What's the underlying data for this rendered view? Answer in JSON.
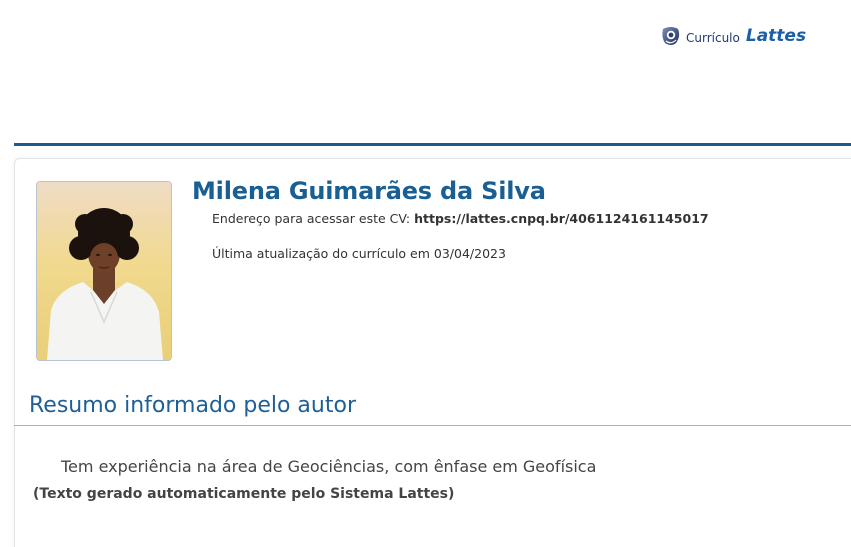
{
  "header": {
    "logo": {
      "prefix": "Currículo",
      "brand": "Lattes",
      "icon": "lattes-logo-icon"
    }
  },
  "profile": {
    "name": "Milena Guimarães da Silva",
    "address_label": "Endereço para acessar este CV: ",
    "address_url": "https://lattes.cnpq.br/4061124161145017",
    "last_update": "Última atualização do currículo em 03/04/2023",
    "photo": "profile-photo"
  },
  "summary_section": {
    "title": "Resumo informado pelo autor",
    "text": "Tem experiência na área de Geociências, com ênfase em Geofísica",
    "auto_note": "(Texto gerado automaticamente pelo Sistema Lattes)"
  },
  "colors": {
    "brand_blue": "#1a5f94",
    "rule_blue": "#1e5b8c",
    "text_gray": "#444444"
  }
}
